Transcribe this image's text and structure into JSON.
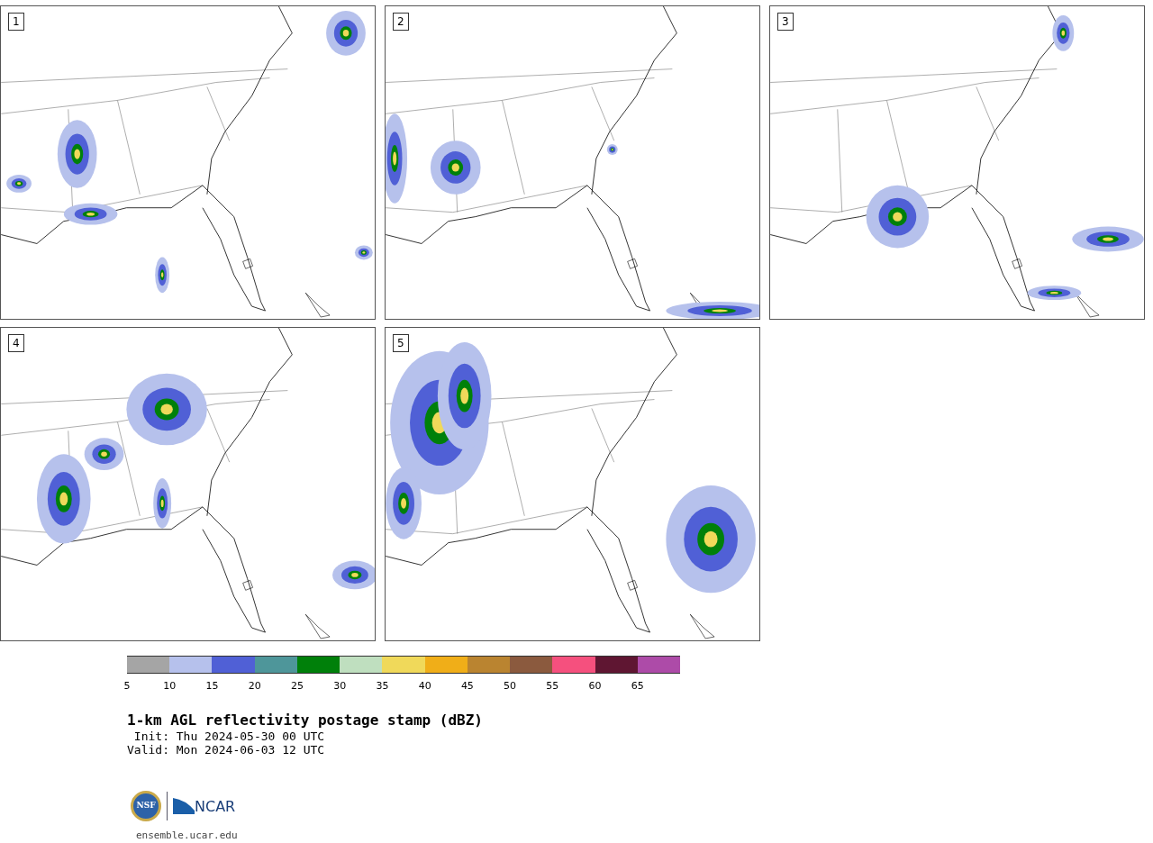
{
  "panels": [
    {
      "label": "1"
    },
    {
      "label": "2"
    },
    {
      "label": "3"
    },
    {
      "label": "4"
    },
    {
      "label": "5"
    }
  ],
  "colorbar": {
    "segments": [
      {
        "color": "#a5a5a5",
        "tick": "5"
      },
      {
        "color": "#b6c1ec",
        "tick": "10"
      },
      {
        "color": "#5060d6",
        "tick": "15"
      },
      {
        "color": "#4e969a",
        "tick": "20"
      },
      {
        "color": "#00800a",
        "tick": "25"
      },
      {
        "color": "#bfdfbf",
        "tick": "30"
      },
      {
        "color": "#f0d95a",
        "tick": "35"
      },
      {
        "color": "#f0ae18",
        "tick": "40"
      },
      {
        "color": "#ba8430",
        "tick": "45"
      },
      {
        "color": "#8b5a3e",
        "tick": "50"
      },
      {
        "color": "#f5507e",
        "tick": "55"
      },
      {
        "color": "#5f1632",
        "tick": "60"
      },
      {
        "color": "#ad4ba8",
        "tick": "65"
      }
    ]
  },
  "title": "1-km AGL reflectivity postage stamp (dBZ)",
  "init": " Init: Thu 2024-05-30 00 UTC",
  "valid": "Valid: Mon 2024-06-03 12 UTC",
  "logo": {
    "nsf": "NSF",
    "ncar": "NCAR"
  },
  "footer": "ensemble.ucar.edu"
}
